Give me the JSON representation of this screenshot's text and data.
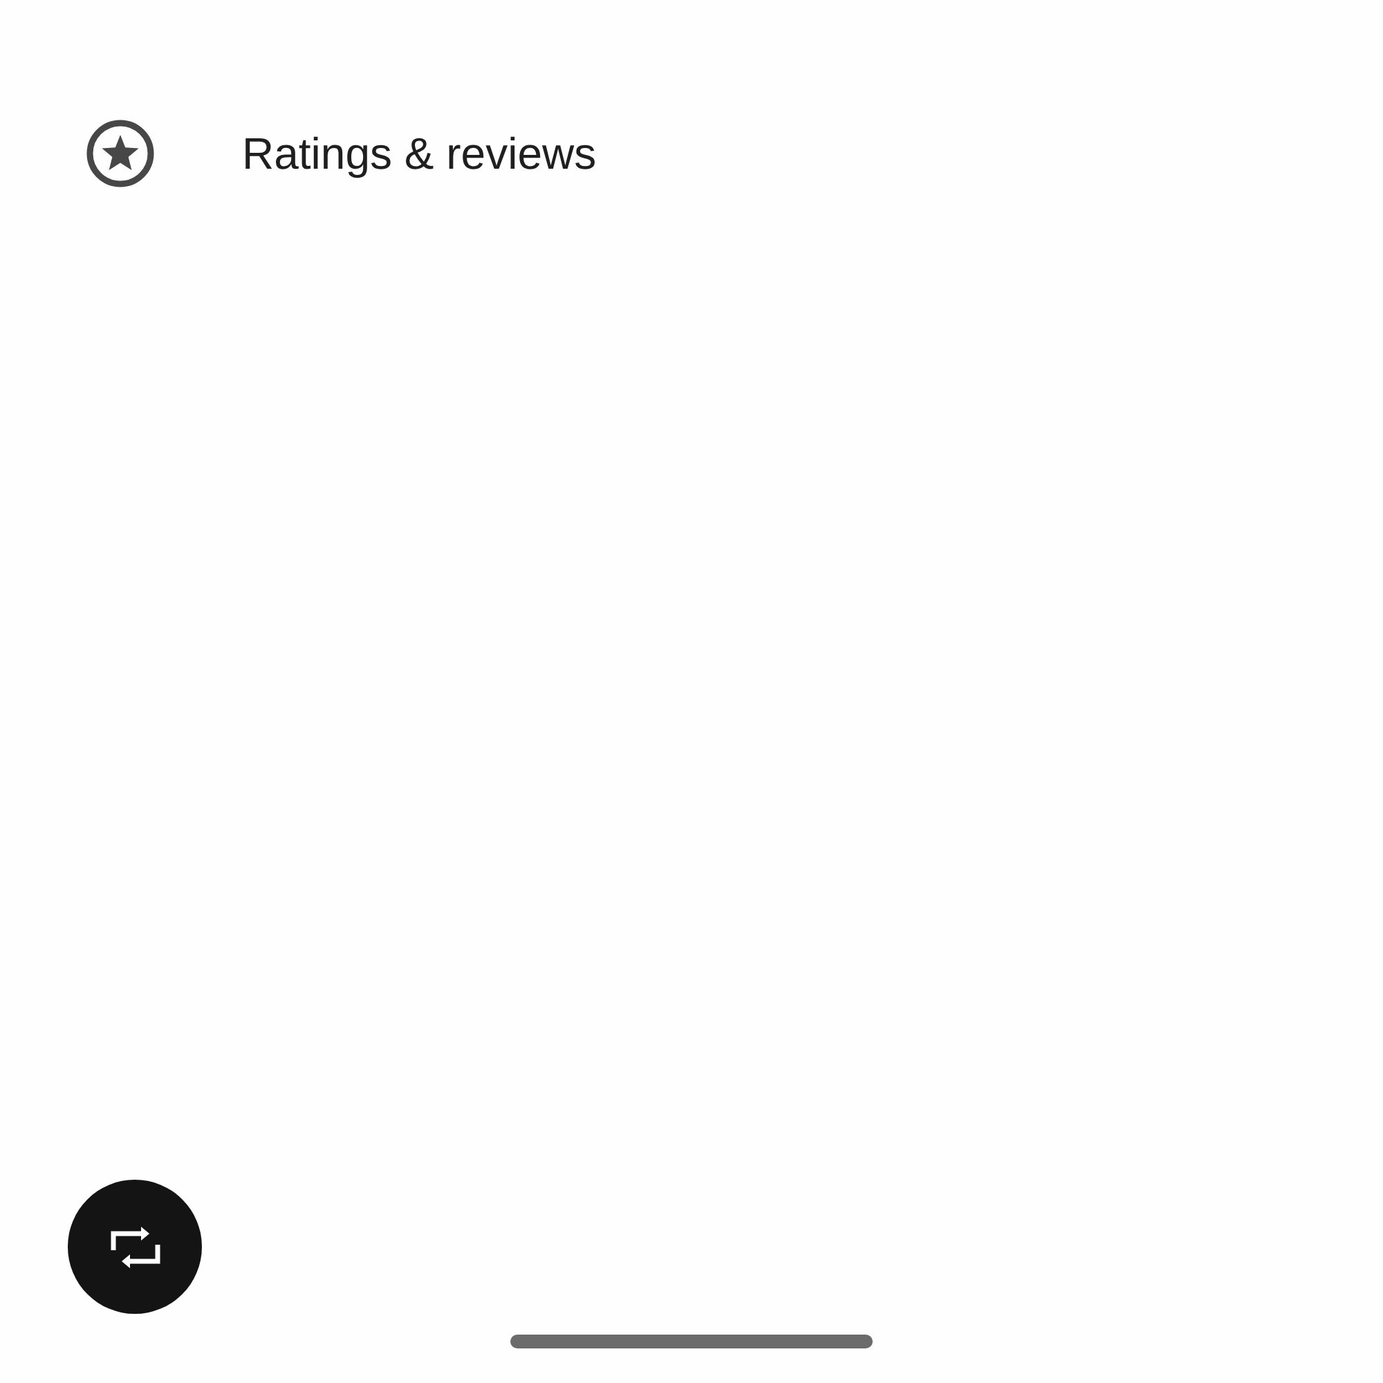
{
  "menu_item": {
    "label": "Ratings & reviews"
  }
}
